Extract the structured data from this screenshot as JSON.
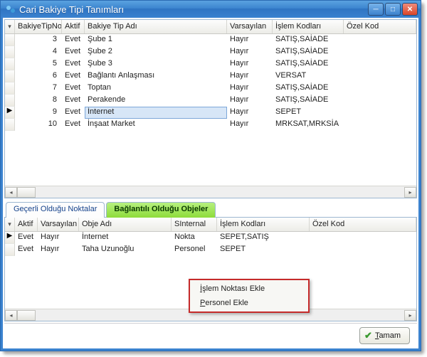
{
  "window": {
    "title": "Cari Bakiye Tipi Tanımları"
  },
  "topGrid": {
    "cols": {
      "no": "BakiyeTipNo",
      "aktif": "Aktif",
      "ad": "Bakiye Tip Adı",
      "vars": "Varsayılan",
      "islem": "İşlem Kodları",
      "ozel": "Özel Kod"
    },
    "rows": [
      {
        "no": "3",
        "aktif": "Evet",
        "ad": "Şube 1",
        "vars": "Hayır",
        "islem": "SATIŞ,SAİADE",
        "ozel": ""
      },
      {
        "no": "4",
        "aktif": "Evet",
        "ad": "Şube 2",
        "vars": "Hayır",
        "islem": "SATIŞ,SAİADE",
        "ozel": ""
      },
      {
        "no": "5",
        "aktif": "Evet",
        "ad": "Şube 3",
        "vars": "Hayır",
        "islem": "SATIŞ,SAİADE",
        "ozel": ""
      },
      {
        "no": "6",
        "aktif": "Evet",
        "ad": "Bağlantı Anlaşması",
        "vars": "Hayır",
        "islem": "VERSAT",
        "ozel": ""
      },
      {
        "no": "7",
        "aktif": "Evet",
        "ad": "Toptan",
        "vars": "Hayır",
        "islem": "SATIŞ,SAİADE",
        "ozel": ""
      },
      {
        "no": "8",
        "aktif": "Evet",
        "ad": "Perakende",
        "vars": "Hayır",
        "islem": "SATIŞ,SAİADE",
        "ozel": ""
      },
      {
        "no": "9",
        "aktif": "Evet",
        "ad": "İnternet",
        "vars": "Hayır",
        "islem": "SEPET",
        "ozel": ""
      },
      {
        "no": "10",
        "aktif": "Evet",
        "ad": "İnşaat Market",
        "vars": "Hayır",
        "islem": "MRKSAT,MRKSİA",
        "ozel": ""
      }
    ],
    "selectedIndex": 6
  },
  "tabs": {
    "t1": "Geçerli Olduğu Noktalar",
    "t2": "Bağlantılı Olduğu Objeler"
  },
  "botGrid": {
    "cols": {
      "aktif": "Aktif",
      "vars": "Varsayılan",
      "obje": "Obje Adı",
      "sint": "SInternal",
      "islem": "İşlem Kodları",
      "ozel": "Özel Kod"
    },
    "rows": [
      {
        "aktif": "Evet",
        "vars": "Hayır",
        "obje": "İnternet",
        "sint": "Nokta",
        "islem": "SEPET,SATIŞ",
        "ozel": ""
      },
      {
        "aktif": "Evet",
        "vars": "Hayır",
        "obje": "Taha Uzunoğlu",
        "sint": "Personel",
        "islem": "SEPET",
        "ozel": ""
      }
    ]
  },
  "contextMenu": {
    "i1_pre": "İ",
    "i1_rest": "şlem Noktası Ekle",
    "i2_pre": "P",
    "i2_rest": "ersonel Ekle"
  },
  "footer": {
    "ok_pre": "T",
    "ok_rest": "amam"
  }
}
